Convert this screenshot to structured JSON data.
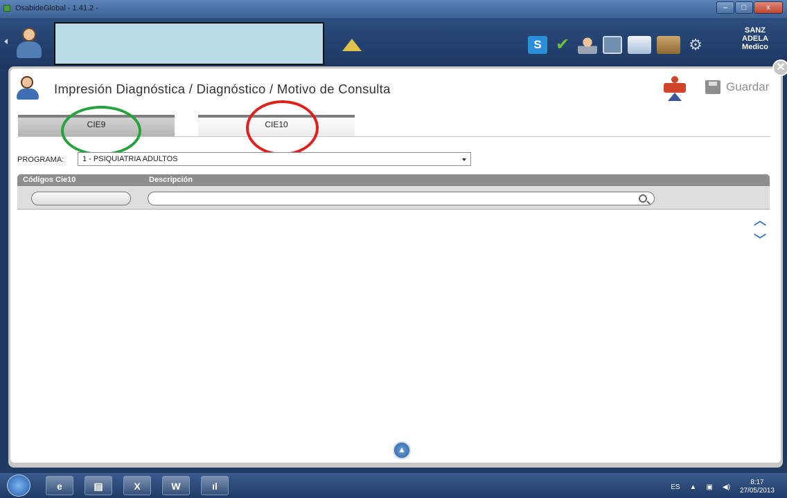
{
  "window": {
    "title": "OsabideGlobal - 1.41.2 -",
    "minimize": "–",
    "maximize": "□",
    "close": "x"
  },
  "header": {
    "user": {
      "line1": "SANZ",
      "line2": "ADELA",
      "line3": "Medico"
    },
    "toolbar_s": "S",
    "check": "✔",
    "gear": "⚙"
  },
  "panel": {
    "title": "Impresión Diagnóstica / Diagnóstico / Motivo de Consulta",
    "save_label": "Guardar",
    "close": "✕",
    "tabs": [
      {
        "label": "CIE9"
      },
      {
        "label": "CIE10"
      }
    ],
    "programa": {
      "label": "PROGRAMA:",
      "selected": "1 - PSIQUIATRIA ADULTOS"
    },
    "grid": {
      "columns": [
        "Códigos Cie10",
        "Descripción"
      ]
    },
    "scroll_up": "︿",
    "scroll_down": "﹀",
    "scroll_top": "▲"
  },
  "taskbar": {
    "apps": [
      {
        "label": "e"
      },
      {
        "label": "▤"
      },
      {
        "label": "X"
      },
      {
        "label": "W"
      },
      {
        "label": "ıl"
      }
    ],
    "language": "ES",
    "time": "8:17",
    "date": "27/05/2013"
  }
}
